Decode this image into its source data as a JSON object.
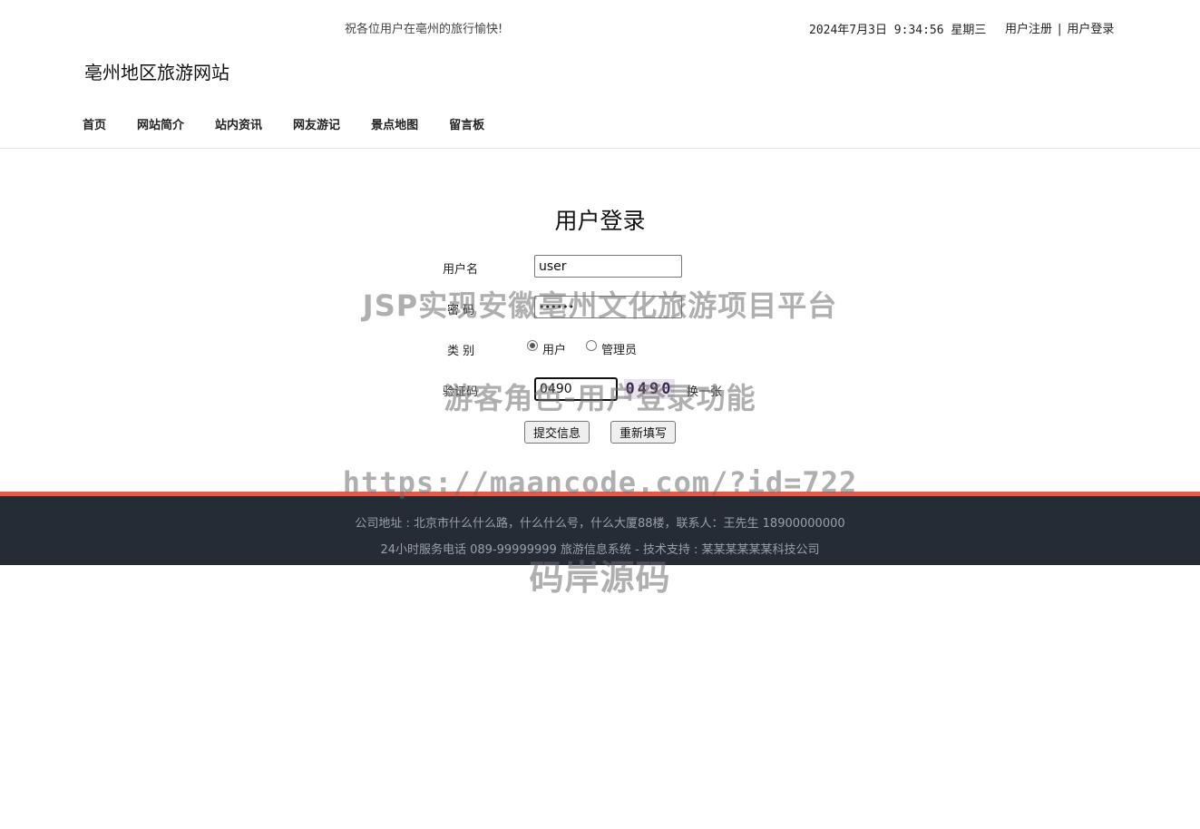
{
  "header": {
    "welcome": "祝各位用户在亳州的旅行愉快!",
    "datetime": "2024年7月3日 9:34:56 星期三",
    "register_link": "用户注册",
    "separator": "|",
    "login_link": "用户登录",
    "site_title": "亳州地区旅游网站"
  },
  "nav": {
    "items": [
      "首页",
      "网站简介",
      "站内资讯",
      "网友游记",
      "景点地图",
      "留言板"
    ]
  },
  "login": {
    "title": "用户登录",
    "username_label": "用户名",
    "username_value": "user",
    "password_label": "密 码",
    "password_value": "••••••",
    "type_label": "类 别",
    "type_options": [
      "用户",
      "管理员"
    ],
    "type_selected": "用户",
    "captcha_label": "验证码",
    "captcha_value": "0490",
    "captcha_image_text": "0490",
    "captcha_refresh": "换一张",
    "submit_label": "提交信息",
    "reset_label": "重新填写"
  },
  "watermarks": [
    "JSP实现安徽亳州文化旅游项目平台",
    "游客角色-用户登录功能",
    "https://maancode.com/?id=722",
    "码岸源码"
  ],
  "footer": {
    "line1": "公司地址 : 北京市什么什么路，什么什么号，什么大厦88楼，联系人：王先生 18900000000",
    "line2": "24小时服务电话   089-99999999   旅游信息系统 - 技术支持 : 某某某某某某科技公司"
  },
  "colors": {
    "footer_bg": "#262c36",
    "footer_accent": "#e25c4d"
  }
}
